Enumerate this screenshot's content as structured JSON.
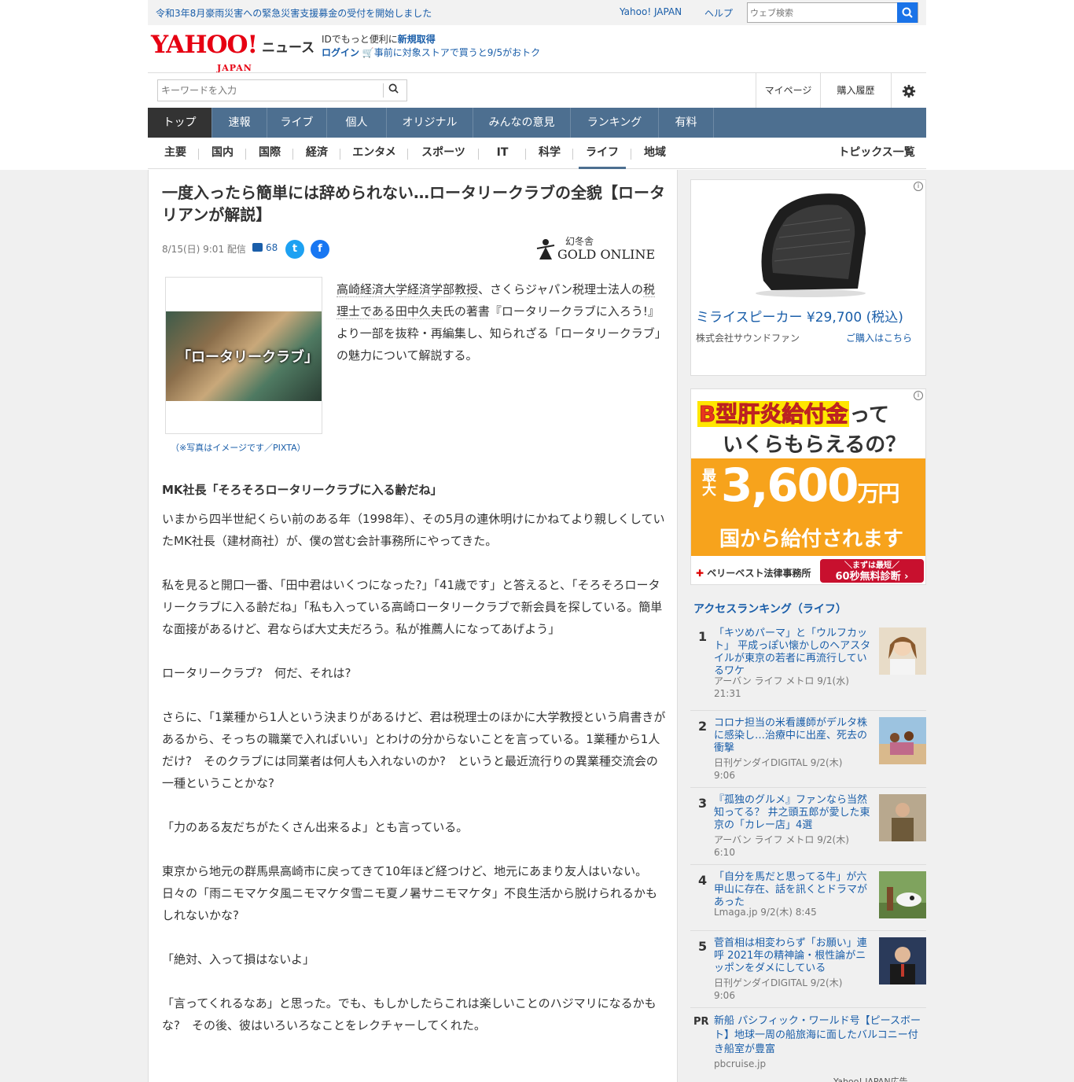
{
  "topbar": {
    "alert": "令和3年8月豪雨災害への緊急災害支援募金の受付を開始しました",
    "yahoo_japan": "Yahoo! JAPAN",
    "help": "ヘルプ",
    "search_placeholder": "ウェブ検索"
  },
  "header": {
    "logo": "YAHOO!",
    "logo_sub": "JAPAN",
    "service": "ニュース",
    "id_text": "IDでもっと便利に",
    "register": "新規取得",
    "login": "ログイン",
    "promo": "事前に対象ストアで買うと9/5がおトク"
  },
  "toolbar": {
    "keyword_placeholder": "キーワードを入力",
    "mypage": "マイページ",
    "history": "購入履歴"
  },
  "nav": {
    "tabs": [
      "トップ",
      "速報",
      "ライブ",
      "個人",
      "オリジナル",
      "みんなの意見",
      "ランキング",
      "有料"
    ],
    "active": "トップ"
  },
  "subnav": {
    "items": [
      "主要",
      "国内",
      "国際",
      "経済",
      "エンタメ",
      "スポーツ",
      "IT",
      "科学",
      "ライフ",
      "地域"
    ],
    "active": "ライフ",
    "topics": "トピックス一覧"
  },
  "article": {
    "title": "一度入ったら簡単には辞められない…ロータリークラブの全貌【ロータリアンが解説】",
    "date": "8/15(日) 9:01 配信",
    "comments": "68",
    "source_kanji": "幻冬舎",
    "source_brand": "GOLD ONLINE",
    "photo_label": "「ロータリークラブ」",
    "caption": "（※写真はイメージです／PIXTA）",
    "lead_1": "高崎経済大学経済学部教授",
    "lead_2": "、さくらジャパン税理士法人の",
    "lead_3": "税理士である田中久夫",
    "lead_4": "氏の著書『ロータリークラブに入ろう!』より一部を抜粋・再編集し、知られざる「ロータリークラブ」の魅力について解説する。",
    "heading": "MK社長「そろそろロータリークラブに入る齢だね」",
    "paragraphs": [
      "いまから四半世紀くらい前のある年（1998年）、その5月の連休明けにかねてより親しくしていたMK社長（建材商社）が、僕の営む会計事務所にやってきた。",
      "私を見ると開口一番、「田中君はいくつになった?」「41歳です」と答えると、「そろそろロータリークラブに入る齢だね」「私も入っている高崎ロータリークラブで新会員を探している。簡単な面接があるけど、君ならば大丈夫だろう。私が推薦人になってあげよう」",
      "ロータリークラブ?　何だ、それは?",
      "さらに、「1業種から1人という決まりがあるけど、君は税理士のほかに大学教授という肩書きがあるから、そっちの職業で入ればいい」とわけの分からないことを言っている。1業種から1人だけ?　そのクラブには同業者は何人も入れないのか?　というと最近流行りの異業種交流会の一種ということかな?",
      "「力のある友だちがたくさん出来るよ」とも言っている。",
      "東京から地元の群馬県高崎市に戻ってきて10年ほど経つけど、地元にあまり友人はいない。日々の「雨ニモマケタ風ニモマケタ雪ニモ夏ノ暑サニモマケタ」不良生活から脱けられるかもしれないかな?",
      "「絶対、入って損はないよ」",
      "「言ってくれるなあ」と思った。でも、もしかしたらこれは楽しいことのハジマリになるかもな?　その後、彼はいろいろなことをレクチャーしてくれた。"
    ]
  },
  "ad1": {
    "name": "ミライスピーカー ¥29,700 (税込)",
    "company": "株式会社サウンドファン",
    "buy": "ご購入はこちら"
  },
  "ad2": {
    "line1_a": "B型肝炎給付金",
    "line1_b": "って",
    "line2": "いくらもらえるの？",
    "max": "最大",
    "amount": "3,600",
    "unit": "万円",
    "line3": "国から給付されます",
    "law": "ベリーベスト法律事務所",
    "cta_small": "＼まずは最短／",
    "cta": "60秒無料診断 ›"
  },
  "ranking": {
    "heading": "アクセスランキング（ライフ）",
    "items": [
      {
        "rank": "1",
        "title": "「キツめパーマ」と「ウルフカット」 平成っぽい懐かしのヘアスタイルが東京の若者に再流行しているワケ",
        "source": "アーバン ライフ メトロ 9/1(水) 21:31"
      },
      {
        "rank": "2",
        "title": "コロナ担当の米看護師がデルタ株に感染し…治療中に出産、死去の衝撃",
        "source": "日刊ゲンダイDIGITAL 9/2(木) 9:06"
      },
      {
        "rank": "3",
        "title": "『孤独のグルメ』ファンなら当然知ってる？ 井之頭五郎が愛した東京の「カレー店」4選",
        "source": "アーバン ライフ メトロ 9/2(木) 6:10"
      },
      {
        "rank": "4",
        "title": "「自分を馬だと思ってる牛」が六甲山に存在、話を訊くとドラマがあった",
        "source": "Lmaga.jp 9/2(木) 8:45"
      },
      {
        "rank": "5",
        "title": "菅首相は相変わらず「お願い」連呼 2021年の精神論・根性論がニッポンをダメにしている",
        "source": "日刊ゲンダイDIGITAL 9/2(木) 9:06"
      }
    ]
  },
  "pr": {
    "label": "PR",
    "title": "新船 パシフィック・ワールド号【ピースボート】地球一周の船旅海に面したバルコニー付き船室が豊富",
    "source": "pbcruise.jp",
    "yahoo_ad": "Yahoo! JAPAN広告"
  }
}
